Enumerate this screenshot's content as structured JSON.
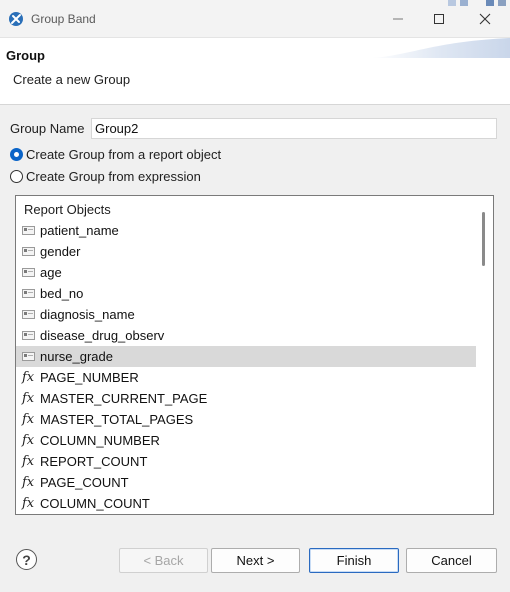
{
  "window": {
    "title": "Group Band",
    "controls": {
      "minimize": "minimize-icon",
      "maximize": "maximize-icon",
      "close": "close-icon"
    }
  },
  "header": {
    "title": "Group",
    "description": "Create a new Group"
  },
  "form": {
    "group_name_label": "Group Name",
    "group_name_value": "Group2",
    "radio_report_object": {
      "label": "Create Group from a report object",
      "checked": true
    },
    "radio_expression": {
      "label": "Create Group from expression",
      "checked": false
    }
  },
  "tree": {
    "root_label": "Report Objects",
    "items": [
      {
        "label": "patient_name",
        "icon": "column-icon",
        "selected": false
      },
      {
        "label": "gender",
        "icon": "column-icon",
        "selected": false
      },
      {
        "label": "age",
        "icon": "column-icon",
        "selected": false
      },
      {
        "label": "bed_no",
        "icon": "column-icon",
        "selected": false
      },
      {
        "label": "diagnosis_name",
        "icon": "column-icon",
        "selected": false
      },
      {
        "label": "disease_drug_observ",
        "icon": "column-icon",
        "selected": false
      },
      {
        "label": "nurse_grade",
        "icon": "column-icon",
        "selected": true
      },
      {
        "label": "PAGE_NUMBER",
        "icon": "function-icon",
        "selected": false
      },
      {
        "label": "MASTER_CURRENT_PAGE",
        "icon": "function-icon",
        "selected": false
      },
      {
        "label": "MASTER_TOTAL_PAGES",
        "icon": "function-icon",
        "selected": false
      },
      {
        "label": "COLUMN_NUMBER",
        "icon": "function-icon",
        "selected": false
      },
      {
        "label": "REPORT_COUNT",
        "icon": "function-icon",
        "selected": false
      },
      {
        "label": "PAGE_COUNT",
        "icon": "function-icon",
        "selected": false
      },
      {
        "label": "COLUMN_COUNT",
        "icon": "function-icon",
        "selected": false
      }
    ],
    "fx_glyph": "fx"
  },
  "footer": {
    "help_glyph": "?",
    "back_label": "< Back",
    "next_label": "Next >",
    "finish_label": "Finish",
    "cancel_label": "Cancel"
  },
  "colors": {
    "accent": "#0a64c8",
    "selection": "#d9d9d9",
    "header_bg": "#ffffff",
    "dialog_bg": "#f0f0f0"
  }
}
